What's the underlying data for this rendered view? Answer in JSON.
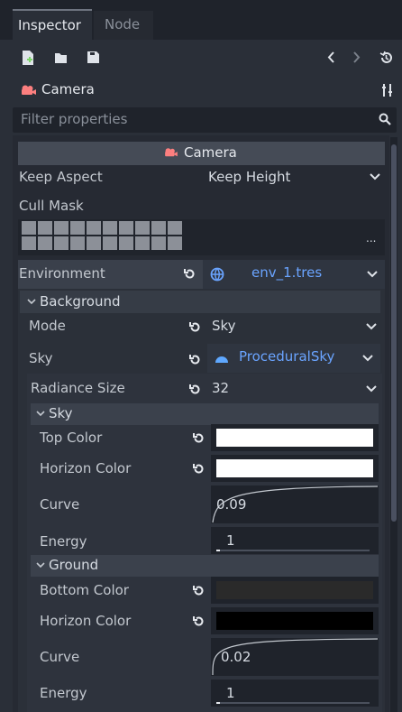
{
  "tabs": [
    {
      "label": "Inspector",
      "active": true
    },
    {
      "label": "Node",
      "active": false
    }
  ],
  "object": {
    "name": "Camera"
  },
  "filter": {
    "placeholder": "Filter properties"
  },
  "section": {
    "title": "Camera"
  },
  "keep_aspect": {
    "label": "Keep Aspect",
    "value": "Keep Height"
  },
  "cull_mask": {
    "label": "Cull Mask",
    "more": "..."
  },
  "environment": {
    "label": "Environment",
    "value": "env_1.tres"
  },
  "background": {
    "title": "Background",
    "mode": {
      "label": "Mode",
      "value": "Sky"
    },
    "sky": {
      "label": "Sky",
      "value": "ProceduralSky"
    },
    "radiance": {
      "label": "Radiance Size",
      "value": "32"
    }
  },
  "sky_group": {
    "title": "Sky",
    "top_color": {
      "label": "Top Color",
      "color": "#ffffff"
    },
    "horizon_color": {
      "label": "Horizon Color",
      "color": "#ffffff"
    },
    "curve": {
      "label": "Curve",
      "value": "0.09"
    },
    "energy": {
      "label": "Energy",
      "value": "1"
    }
  },
  "ground_group": {
    "title": "Ground",
    "bottom_color": {
      "label": "Bottom Color",
      "color": "#2a2a2a"
    },
    "horizon_color": {
      "label": "Horizon Color",
      "color": "#000000"
    },
    "curve": {
      "label": "Curve",
      "value": "0.02"
    },
    "energy": {
      "label": "Energy",
      "value": "1"
    }
  },
  "icons": {
    "new": "new-resource-icon",
    "open": "folder-open-icon",
    "save": "save-icon",
    "back": "chevron-left-icon",
    "forward": "chevron-right-icon",
    "history": "history-icon",
    "camera": "camera-icon",
    "tools": "tools-icon",
    "search": "search-icon",
    "revert": "revert-icon",
    "dropdown": "chevron-down-icon",
    "globe": "globe-icon",
    "sky": "sky-icon"
  }
}
